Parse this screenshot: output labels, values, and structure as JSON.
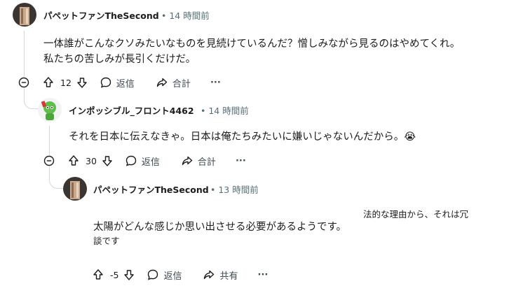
{
  "comments": [
    {
      "username": "パペットファンTheSecond",
      "time": "• 14 時間前",
      "text": "一体誰がこんなクソみたいなものを見続けているんだ？憎しみながら見るのはやめてくれ。私たちの苦しみが長引くだけだ。",
      "votes": "12",
      "reply_label": "返信",
      "share_label": "合計",
      "more_label": "···"
    },
    {
      "username": "インポッシブル_フロント4462",
      "time": "• 14 時間前",
      "text": "それを日本に伝えなきゃ。日本は俺たちみたいに嫌いじゃないんだから。😭",
      "votes": "30",
      "reply_label": "返信",
      "share_label": "合計",
      "more_label": "···"
    },
    {
      "username": "パペットファンTheSecond",
      "time": "• 13 時間前",
      "text_main": "太陽がどんな感じか思い出させる必要があるようです。",
      "text_side": "法的な理由から、それは冗",
      "text_tail": "談です",
      "votes": "-5",
      "reply_label": "返信",
      "share_label": "共有",
      "more_label": "···"
    }
  ],
  "colors": {
    "text": "#1c1c1c",
    "meta": "#576f76",
    "line": "#d4d8da"
  }
}
